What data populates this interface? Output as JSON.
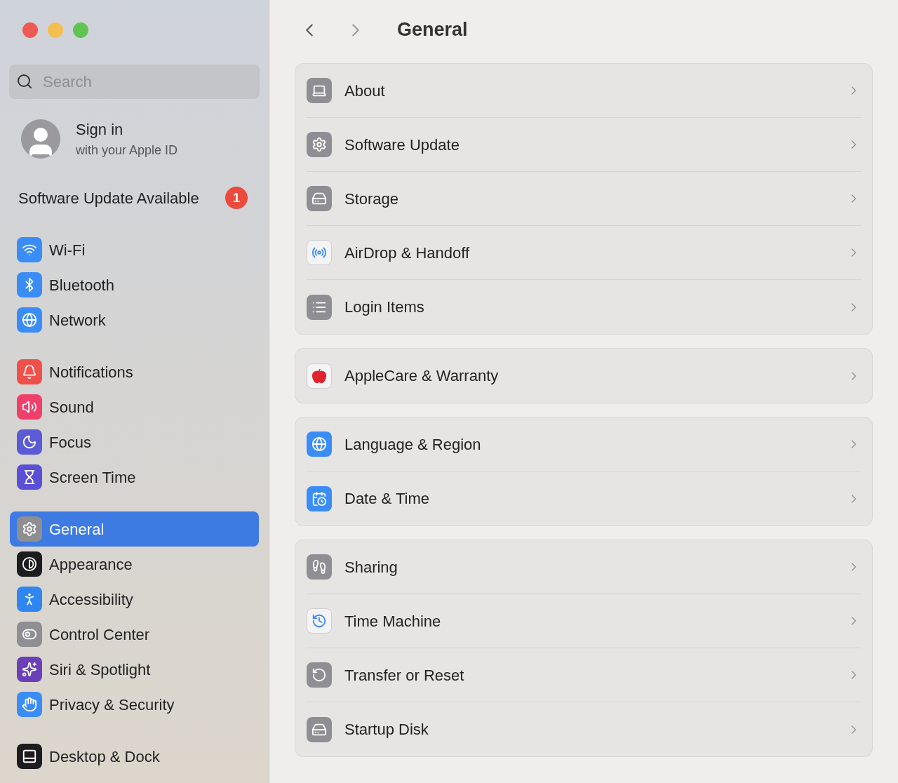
{
  "sidebar": {
    "search": {
      "placeholder": "Search"
    },
    "account": {
      "title": "Sign in",
      "subtitle": "with your Apple ID"
    },
    "update_notice": {
      "label": "Software Update Available",
      "badge": "1"
    },
    "groups": [
      [
        {
          "label": "Wi-Fi",
          "color": "#3a8cf7",
          "selected": false
        },
        {
          "label": "Bluetooth",
          "color": "#3a8cf7",
          "selected": false
        },
        {
          "label": "Network",
          "color": "#3a8cf7",
          "selected": false
        }
      ],
      [
        {
          "label": "Notifications",
          "color": "#f0504a",
          "selected": false
        },
        {
          "label": "Sound",
          "color": "#ef3f6a",
          "selected": false
        },
        {
          "label": "Focus",
          "color": "#5b5bd6",
          "selected": false
        },
        {
          "label": "Screen Time",
          "color": "#5b4fd6",
          "selected": false
        }
      ],
      [
        {
          "label": "General",
          "color": "#8e8e93",
          "selected": true
        },
        {
          "label": "Appearance",
          "color": "#1c1c1e",
          "selected": false
        },
        {
          "label": "Accessibility",
          "color": "#2f86f0",
          "selected": false
        },
        {
          "label": "Control Center",
          "color": "#8e8e93",
          "selected": false
        },
        {
          "label": "Siri & Spotlight",
          "color": "#6a3fb8",
          "selected": false
        },
        {
          "label": "Privacy & Security",
          "color": "#3a8cf7",
          "selected": false
        }
      ],
      [
        {
          "label": "Desktop & Dock",
          "color": "#1c1c1e",
          "selected": false
        }
      ]
    ]
  },
  "header": {
    "title": "General"
  },
  "cards": [
    [
      {
        "label": "About"
      },
      {
        "label": "Software Update"
      },
      {
        "label": "Storage"
      },
      {
        "label": "AirDrop & Handoff"
      },
      {
        "label": "Login Items"
      }
    ],
    [
      {
        "label": "AppleCare & Warranty"
      }
    ],
    [
      {
        "label": "Language & Region"
      },
      {
        "label": "Date & Time"
      }
    ],
    [
      {
        "label": "Sharing"
      },
      {
        "label": "Time Machine"
      },
      {
        "label": "Transfer or Reset"
      },
      {
        "label": "Startup Disk"
      }
    ]
  ]
}
